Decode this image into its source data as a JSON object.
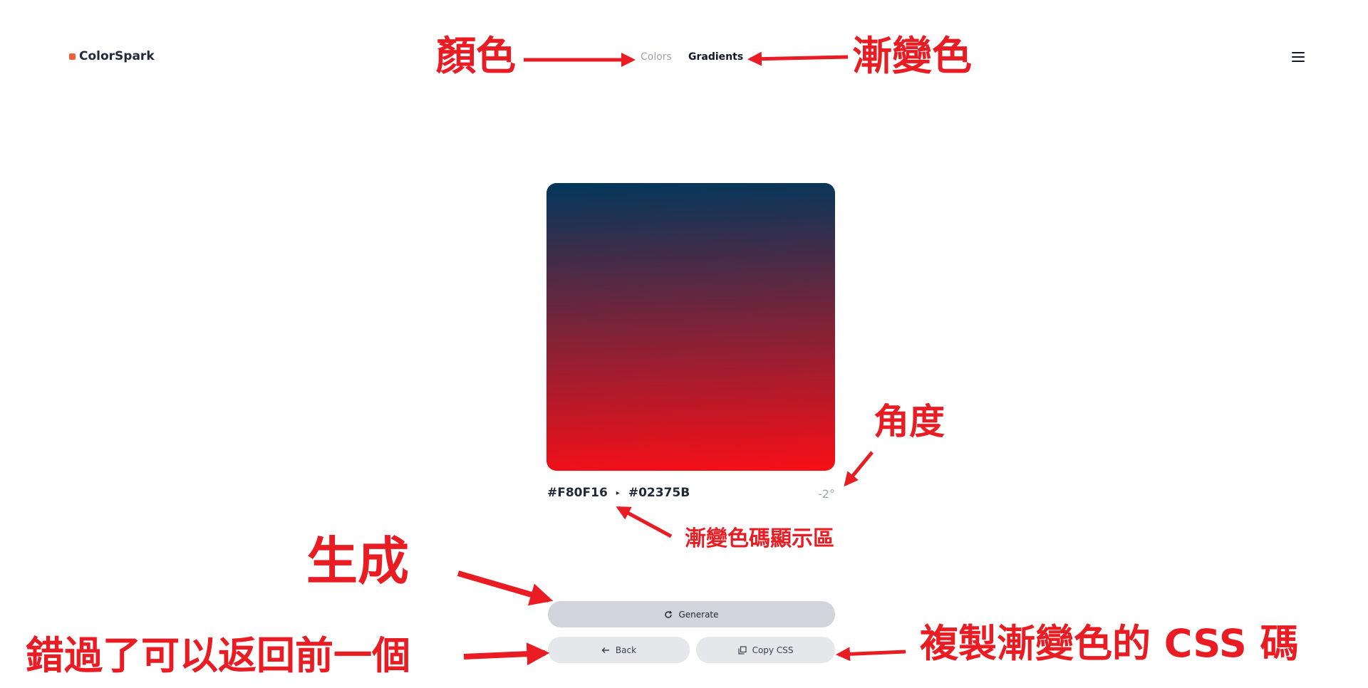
{
  "header": {
    "logo_text": "ColorSpark",
    "nav": {
      "colors_label": "Colors",
      "gradients_label": "Gradients"
    }
  },
  "gradient": {
    "color_start": "#F80F16",
    "color_end": "#02375B",
    "start_label": "#F80F16",
    "separator": "▸",
    "end_label": "#02375B",
    "angle_label": "-2°"
  },
  "buttons": {
    "generate_label": "Generate",
    "back_label": "Back",
    "copy_css_label": "Copy CSS"
  },
  "annotations": {
    "colors": "顏色",
    "gradients": "漸變色",
    "angle": "角度",
    "code_area": "漸變色碼顯示區",
    "generate": "生成",
    "back": "錯過了可以返回前一個",
    "copy_css": "複製漸變色的 CSS 碼"
  },
  "colors": {
    "annotation_red": "#e81c22",
    "logo_accent": "#f0603c"
  }
}
